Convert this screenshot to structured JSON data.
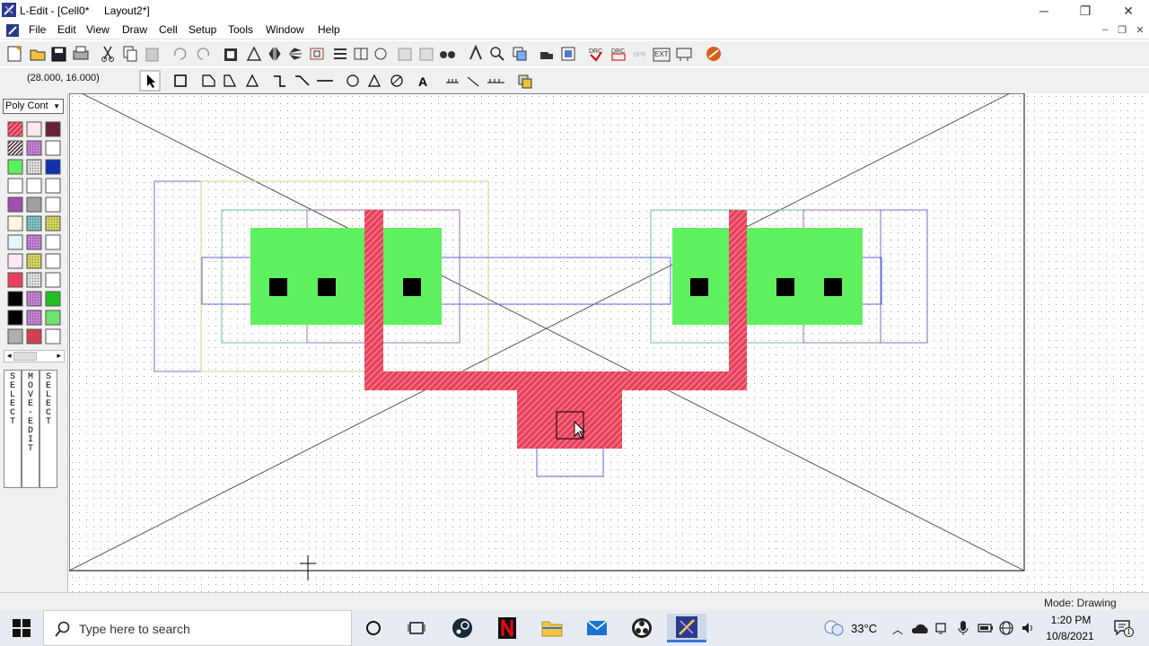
{
  "window": {
    "title": "L-Edit - [Cell0*     Layout2*]",
    "controls": [
      "minimize",
      "restore",
      "close"
    ]
  },
  "menu": {
    "items": [
      "File",
      "Edit",
      "View",
      "Draw",
      "Cell",
      "Setup",
      "Tools",
      "Window",
      "Help"
    ]
  },
  "toolbar2": {
    "cursor_coords": "(28.000, 16.000)"
  },
  "palette": {
    "layer_selected": "Poly Cont",
    "mouse_button_labels": [
      "SELECT",
      "MOVE-EDIT",
      "SELECT"
    ]
  },
  "status": {
    "mode": "Mode: Drawing"
  },
  "taskbar": {
    "search_placeholder": "Type here to search",
    "temperature": "33°C",
    "time": "1:20 PM",
    "date": "10/8/2021",
    "notification_count": "1"
  },
  "colors": {
    "poly": "#e8405a",
    "active": "#5ef05e",
    "contact": "#000000",
    "metal_outline": "#5a5ae0",
    "grid_dot": "#9a9a9a"
  }
}
